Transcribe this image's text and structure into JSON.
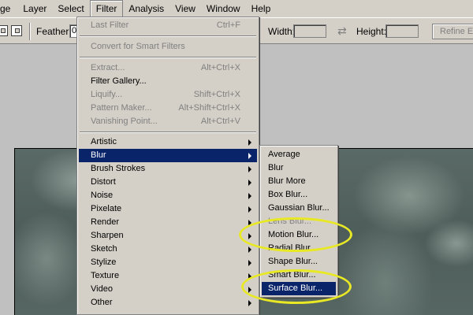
{
  "menubar": {
    "items": [
      "ge",
      "Layer",
      "Select",
      "Filter",
      "Analysis",
      "View",
      "Window",
      "Help"
    ]
  },
  "options": {
    "feather_label": "Feather:",
    "feather_value": "0",
    "width_label": "Width:",
    "height_label": "Height:",
    "refine_label": "Refine Ed"
  },
  "filter_menu": {
    "last_filter": {
      "label": "Last Filter",
      "shortcut": "Ctrl+F"
    },
    "convert": {
      "label": "Convert for Smart Filters"
    },
    "extract": {
      "label": "Extract...",
      "shortcut": "Alt+Ctrl+X"
    },
    "gallery": {
      "label": "Filter Gallery..."
    },
    "liquify": {
      "label": "Liquify...",
      "shortcut": "Shift+Ctrl+X"
    },
    "pattern": {
      "label": "Pattern Maker...",
      "shortcut": "Alt+Shift+Ctrl+X"
    },
    "vanishing": {
      "label": "Vanishing Point...",
      "shortcut": "Alt+Ctrl+V"
    },
    "categories": [
      "Artistic",
      "Blur",
      "Brush Strokes",
      "Distort",
      "Noise",
      "Pixelate",
      "Render",
      "Sharpen",
      "Sketch",
      "Stylize",
      "Texture",
      "Video",
      "Other"
    ]
  },
  "blur_menu": {
    "items": [
      "Average",
      "Blur",
      "Blur More",
      "Box Blur...",
      "Gaussian Blur...",
      "Lens Blur...",
      "Motion Blur...",
      "Radial Blur...",
      "Shape Blur...",
      "Smart Blur...",
      "Surface Blur..."
    ]
  },
  "colors": {
    "menu_bg": "#d4d0c8",
    "highlight": "#0a246a",
    "annotation": "#e8e825"
  }
}
